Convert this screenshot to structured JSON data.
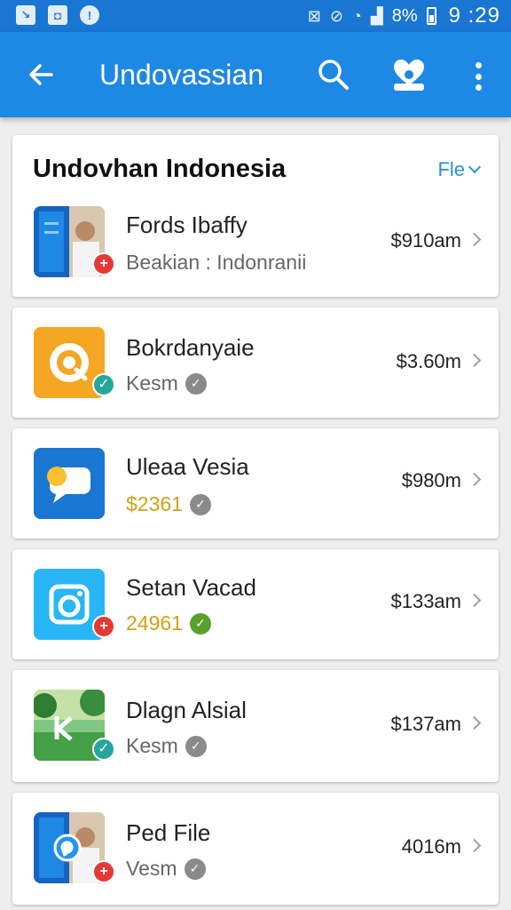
{
  "status_bar": {
    "battery": "8%",
    "time": "9 :29"
  },
  "app_bar": {
    "title": "Undovassian"
  },
  "section": {
    "title": "Undovhan Indonesia",
    "filter_label": "Fle"
  },
  "items": [
    {
      "title": "Fords Ibaffy",
      "subtitle": "Beakian : Indonranii",
      "price": "$910am",
      "badge": "+",
      "thumb_icon": "photo-thumbnail",
      "verified": false
    },
    {
      "title": "Bokrdanyaie",
      "subtitle": "Kesm",
      "price": "$3.60m",
      "badge": "✓",
      "thumb_icon": "target-app-icon",
      "verified": true,
      "verify_color": "gray"
    },
    {
      "title": "Uleaa Vesia",
      "subtitle": "$2361",
      "price": "$980m",
      "badge": "",
      "thumb_icon": "chat-bubble-app-icon",
      "verified": true,
      "verify_color": "gray"
    },
    {
      "title": "Setan Vacad",
      "subtitle": "24961",
      "price": "$133am",
      "badge": "+",
      "thumb_icon": "camera-app-icon",
      "verified": true,
      "verify_color": "green"
    },
    {
      "title": "Dlagn Alsial",
      "subtitle": "Kesm",
      "price": "$137am",
      "badge": "✓",
      "thumb_icon": "park-photo-thumbnail",
      "verified": true,
      "verify_color": "gray"
    },
    {
      "title": "Ped File",
      "subtitle": "Vesm",
      "price": "4016m",
      "badge": "+",
      "thumb_icon": "photo-thumbnail",
      "verified": true,
      "verify_color": "gray"
    }
  ],
  "colors": {
    "status_bar": "#1976d2",
    "app_bar": "#1e88e5",
    "accent": "#2a8fd8",
    "gold_text": "#d4a017",
    "badge_red": "#e53935",
    "badge_green": "#26a69a"
  }
}
